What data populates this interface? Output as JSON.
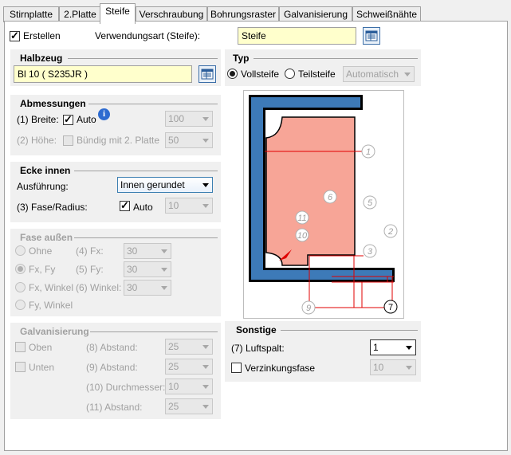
{
  "tabs": [
    "Stirnplatte",
    "2.Platte",
    "Steife",
    "Verschraubung",
    "Bohrungsraster",
    "Galvanisierung",
    "Schweißnähte"
  ],
  "active_tab": "Steife",
  "top": {
    "erstellen_label": "Erstellen",
    "erstellen_checked": true,
    "verwendungsart_label": "Verwendungsart (Steife):",
    "verwendungsart_value": "Steife"
  },
  "halbzeug": {
    "title": "Halbzeug",
    "value": "Bl 10  ( S235JR )"
  },
  "typ": {
    "title": "Typ",
    "voll": "Vollsteife",
    "teil": "Teilsteife",
    "mode": "Automatisch",
    "selected": "Vollsteife"
  },
  "abmessungen": {
    "title": "Abmessungen",
    "breite_label": "(1) Breite:",
    "breite_auto": "Auto",
    "breite_value": "100",
    "hoehe_label": "(2) Höhe:",
    "hoehe_check": "Bündig mit 2. Platte",
    "hoehe_value": "50"
  },
  "ecke": {
    "title": "Ecke innen",
    "ausfuehrung_label": "Ausführung:",
    "ausfuehrung_value": "Innen gerundet",
    "fase_label": "(3) Fase/Radius:",
    "fase_auto": "Auto",
    "fase_value": "10"
  },
  "fase_aussen": {
    "title": "Fase außen",
    "ohne": "Ohne",
    "fxfy": "Fx, Fy",
    "fxwinkel": "Fx, Winkel",
    "fywinkel": "Fy, Winkel",
    "fx_label": "(4) Fx:",
    "fx_value": "30",
    "fy_label": "(5) Fy:",
    "fy_value": "30",
    "winkel_label": "(6) Winkel:",
    "winkel_value": "30"
  },
  "galvanisierung": {
    "title": "Galvanisierung",
    "oben": "Oben",
    "unten": "Unten",
    "a8_label": "(8) Abstand:",
    "a8_value": "25",
    "a9_label": "(9) Abstand:",
    "a9_value": "25",
    "d10_label": "(10) Durchmesser:",
    "d10_value": "10",
    "a11_label": "(11) Abstand:",
    "a11_value": "25"
  },
  "sonstige": {
    "title": "Sonstige",
    "luftspalt_label": "(7) Luftspalt:",
    "luftspalt_value": "1",
    "verzinkung_label": "Verzinkungsfase",
    "verzinkung_value": "10"
  },
  "diagram_labels": [
    "1",
    "2",
    "3",
    "5",
    "6",
    "7",
    "9",
    "10",
    "11"
  ],
  "colors": {
    "profile_blue": "#3d7ab8",
    "stiffener": "#f7a597",
    "dim_red": "#e00000",
    "field_yellow": "#ffffcc"
  }
}
